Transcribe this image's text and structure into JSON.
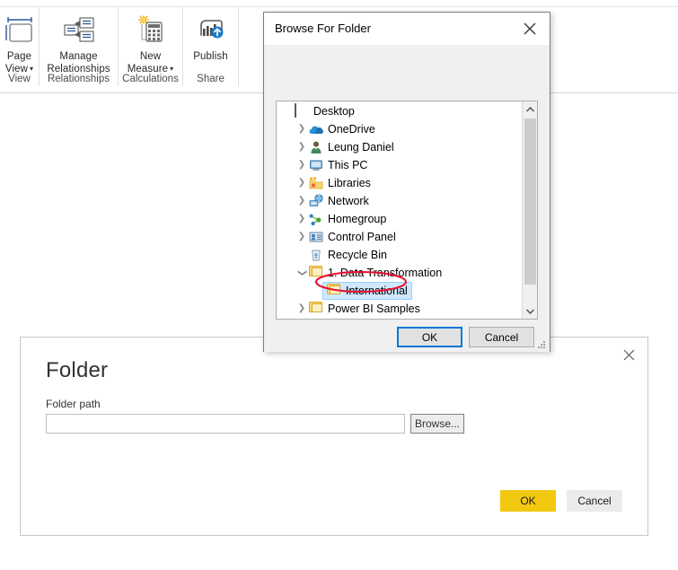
{
  "ribbon": {
    "groups": [
      {
        "title": "View",
        "buttons": [
          {
            "label_line1": "Page",
            "label_line2": "View",
            "has_caret": true,
            "icon": "page-view-icon"
          }
        ]
      },
      {
        "title": "Relationships",
        "buttons": [
          {
            "label_line1": "Manage",
            "label_line2": "Relationships",
            "has_caret": false,
            "icon": "manage-relationships-icon"
          }
        ]
      },
      {
        "title": "Calculations",
        "buttons": [
          {
            "label_line1": "New",
            "label_line2": "Measure",
            "has_caret": true,
            "icon": "new-measure-icon"
          }
        ]
      },
      {
        "title": "Share",
        "buttons": [
          {
            "label_line1": "Publish",
            "label_line2": "",
            "has_caret": false,
            "icon": "publish-icon"
          }
        ]
      }
    ]
  },
  "browse_dialog": {
    "title": "Browse For Folder",
    "close_icon": "close-icon",
    "scrollbar": {
      "up_icon": "chevron-up-icon",
      "down_icon": "chevron-down-icon"
    },
    "tree": [
      {
        "label": "Desktop",
        "indent": 0,
        "chevron": "none",
        "icon": "desktop-icon",
        "selected": false
      },
      {
        "label": "OneDrive",
        "indent": 1,
        "chevron": "collapsed",
        "icon": "onedrive-icon",
        "selected": false
      },
      {
        "label": "Leung Daniel",
        "indent": 1,
        "chevron": "collapsed",
        "icon": "user-icon",
        "selected": false
      },
      {
        "label": "This PC",
        "indent": 1,
        "chevron": "collapsed",
        "icon": "this-pc-icon",
        "selected": false
      },
      {
        "label": "Libraries",
        "indent": 1,
        "chevron": "collapsed",
        "icon": "libraries-icon",
        "selected": false
      },
      {
        "label": "Network",
        "indent": 1,
        "chevron": "collapsed",
        "icon": "network-icon",
        "selected": false
      },
      {
        "label": "Homegroup",
        "indent": 1,
        "chevron": "collapsed",
        "icon": "homegroup-icon",
        "selected": false
      },
      {
        "label": "Control Panel",
        "indent": 1,
        "chevron": "collapsed",
        "icon": "control-panel-icon",
        "selected": false
      },
      {
        "label": "Recycle Bin",
        "indent": 1,
        "chevron": "none",
        "icon": "recycle-bin-icon",
        "selected": false
      },
      {
        "label": "1. Data Transformation",
        "indent": 1,
        "chevron": "expanded",
        "icon": "folder-icon",
        "selected": false
      },
      {
        "label": "International",
        "indent": 2,
        "chevron": "none",
        "icon": "folder-icon",
        "selected": true
      },
      {
        "label": "Power BI Samples",
        "indent": 1,
        "chevron": "collapsed",
        "icon": "folder-icon",
        "selected": false
      }
    ],
    "ok_label": "OK",
    "cancel_label": "Cancel"
  },
  "folder_dialog": {
    "heading": "Folder",
    "close_icon": "close-icon",
    "path_label": "Folder path",
    "path_value": "",
    "path_placeholder": "",
    "browse_label": "Browse...",
    "ok_label": "OK",
    "cancel_label": "Cancel"
  },
  "annotation": {
    "shape": "ellipse",
    "color": "#e8112d",
    "target": "International"
  }
}
